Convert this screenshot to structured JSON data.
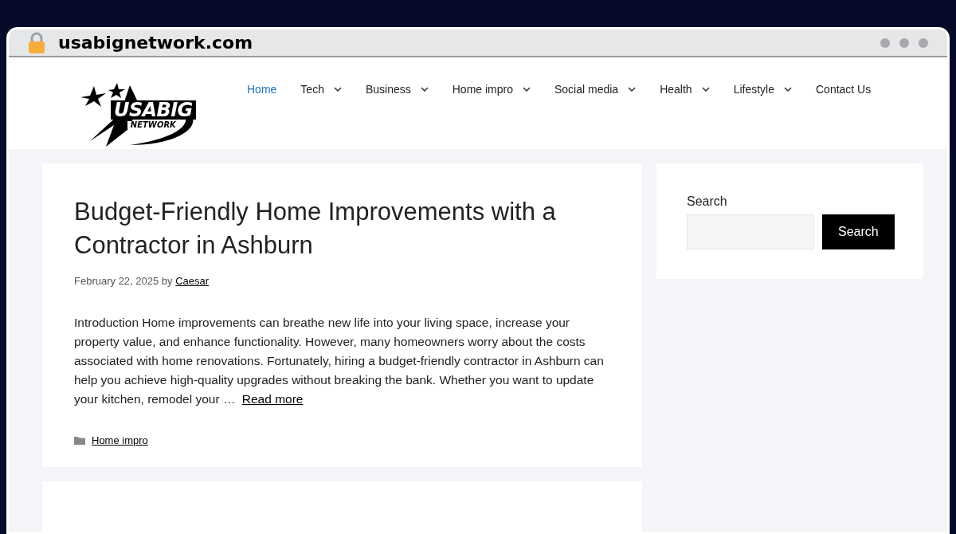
{
  "browser": {
    "address": "usabignetwork.com"
  },
  "logo": {
    "title": "USABIG",
    "subtitle": "NETWORK"
  },
  "nav": [
    {
      "label": "Home",
      "selected": true,
      "dropdown": false
    },
    {
      "label": "Tech",
      "selected": false,
      "dropdown": true
    },
    {
      "label": "Business",
      "selected": false,
      "dropdown": true
    },
    {
      "label": "Home impro",
      "selected": false,
      "dropdown": true
    },
    {
      "label": "Social media",
      "selected": false,
      "dropdown": true
    },
    {
      "label": "Health",
      "selected": false,
      "dropdown": true
    },
    {
      "label": "Lifestyle",
      "selected": false,
      "dropdown": true
    },
    {
      "label": "Contact Us",
      "selected": false,
      "dropdown": false
    }
  ],
  "article": {
    "title": "Budget-Friendly Home Improvements with a Contractor in Ashburn",
    "date": "February 22, 2025",
    "by": "by",
    "author": "Caesar",
    "excerpt": "Introduction Home improvements can breathe new life into your living space, increase your property value, and enhance functionality. However, many homeowners worry about the costs associated with home renovations. Fortunately, hiring a budget-friendly contractor in Ashburn can help you achieve high-quality upgrades without breaking the bank. Whether you want to update your kitchen, remodel your …",
    "read_more": "Read more",
    "category": "Home impro"
  },
  "sidebar": {
    "search_label": "Search",
    "search_button": "Search"
  }
}
